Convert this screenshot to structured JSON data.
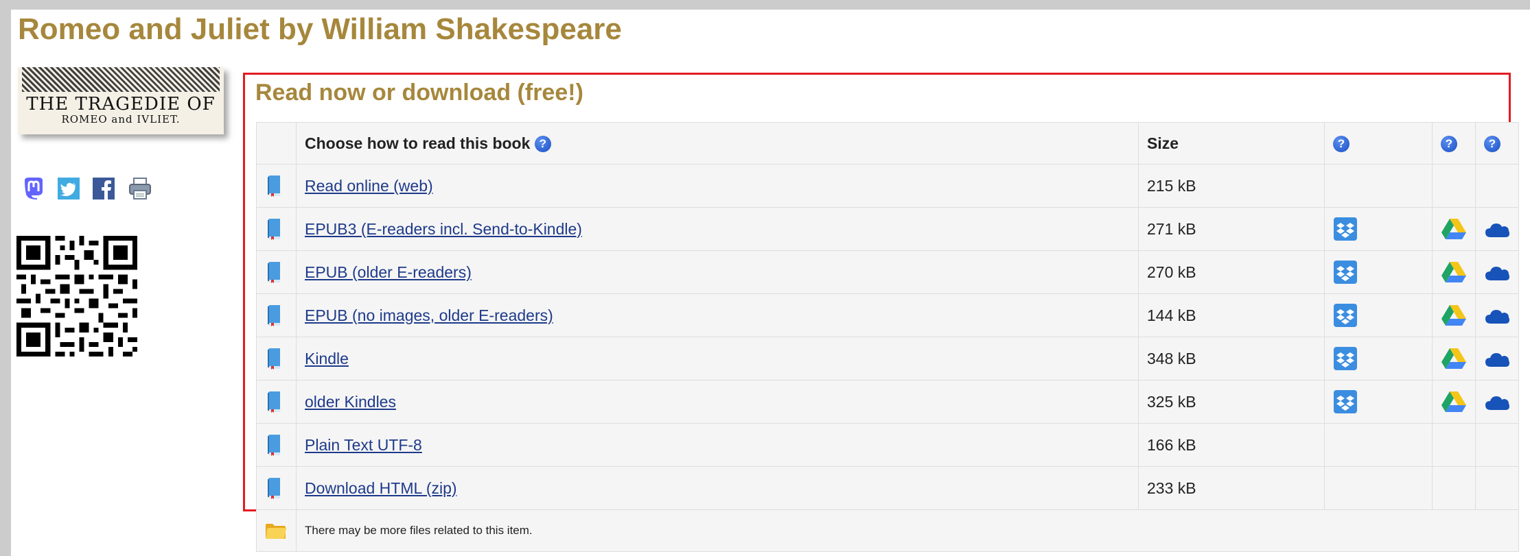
{
  "page": {
    "title": "Romeo and Juliet by William Shakespeare"
  },
  "cover": {
    "line1": "THE TRAGEDIE OF",
    "line2": "ROMEO and IVLIET."
  },
  "share": [
    {
      "icon": "mastodon-icon"
    },
    {
      "icon": "twitter-icon"
    },
    {
      "icon": "facebook-icon"
    },
    {
      "icon": "print-icon"
    }
  ],
  "download": {
    "heading": "Read now or download (free!)",
    "columns": {
      "format": "Choose how to read this book",
      "size": "Size",
      "help_glyph": "?"
    },
    "rows": [
      {
        "label": "Read online (web)",
        "size": "215 kB",
        "cloud": false
      },
      {
        "label": "EPUB3 (E-readers incl. Send-to-Kindle)",
        "size": "271 kB",
        "cloud": true
      },
      {
        "label": "EPUB (older E-readers)",
        "size": "270 kB",
        "cloud": true
      },
      {
        "label": "EPUB (no images, older E-readers)",
        "size": "144 kB",
        "cloud": true
      },
      {
        "label": "Kindle",
        "size": "348 kB",
        "cloud": true
      },
      {
        "label": "older Kindles",
        "size": "325 kB",
        "cloud": true
      },
      {
        "label": "Plain Text UTF-8",
        "size": "166 kB",
        "cloud": false
      },
      {
        "label": "Download HTML (zip)",
        "size": "233 kB",
        "cloud": false
      }
    ],
    "note": "There may be more files related to this item."
  },
  "colors": {
    "title": "#a6873c",
    "panel_border": "#e31b23",
    "link": "#1e3a8a"
  }
}
